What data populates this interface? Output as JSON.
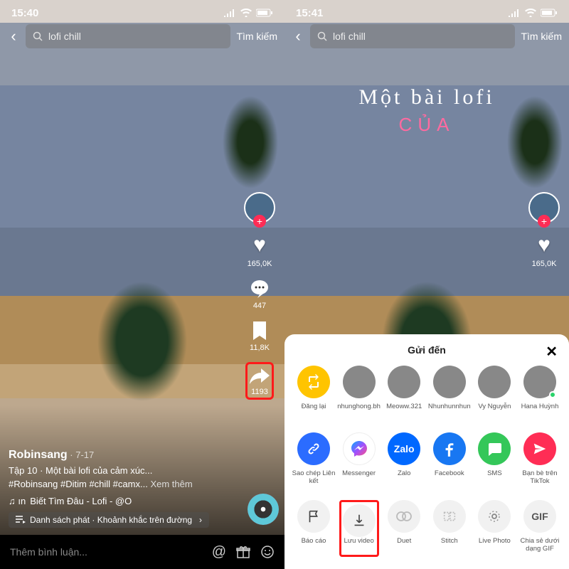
{
  "left": {
    "time": "15:40",
    "search_value": "lofi chill",
    "search_btn": "Tìm kiếm",
    "signal": "•ıl",
    "wifi": "wifi",
    "battery": "batt",
    "likes": "165,0K",
    "comments": "447",
    "bookmarks": "11,8K",
    "shares": "1193",
    "username": "Robinsang",
    "date": "7-17",
    "caption_line": "Tập 10 · Một bài lofi của cảm xúc...",
    "hashtags": "#Robinsang #Ditim #chill #camx...",
    "see_more": "Xem thêm",
    "music": "Biết Tìm Đâu - Lofi - @O",
    "music_prefix": "♫ ın",
    "playlist": "Danh sách phát · Khoảnh khắc trên đường",
    "comment_placeholder": "Thêm bình luận..."
  },
  "right": {
    "time": "15:41",
    "search_value": "lofi chill",
    "search_btn": "Tìm kiếm",
    "likes": "165,0K",
    "overlay_line1": "Một bài lofi",
    "overlay_line2": "CỦA",
    "sheet_title": "Gửi đến",
    "contacts": [
      {
        "label": "Đăng lại",
        "type": "repost"
      },
      {
        "label": "nhunghong.bh",
        "type": "avatar"
      },
      {
        "label": "Meoww.321",
        "type": "avatar"
      },
      {
        "label": "Nhunhunnhun",
        "type": "avatar"
      },
      {
        "label": "Vy Nguyễn",
        "type": "avatar"
      },
      {
        "label": "Hana Huỳnh",
        "type": "avatar"
      }
    ],
    "apps": [
      {
        "label": "Sao chép Liên kết",
        "icon": "link",
        "color": "#2b6cff"
      },
      {
        "label": "Messenger",
        "icon": "msgr",
        "color": "#fff"
      },
      {
        "label": "Zalo",
        "icon": "zalo",
        "color": "#0068ff"
      },
      {
        "label": "Facebook",
        "icon": "fb",
        "color": "#1877f2"
      },
      {
        "label": "SMS",
        "icon": "sms",
        "color": "#34c759"
      },
      {
        "label": "Bạn bè trên TikTok",
        "icon": "send",
        "color": "#ff2d55"
      }
    ],
    "actions": [
      {
        "label": "Báo cáo",
        "icon": "flag"
      },
      {
        "label": "Lưu video",
        "icon": "download",
        "highlight": true
      },
      {
        "label": "Duet",
        "icon": "duet"
      },
      {
        "label": "Stitch",
        "icon": "stitch"
      },
      {
        "label": "Live Photo",
        "icon": "live"
      },
      {
        "label": "Chia sẻ dưới dạng GIF",
        "icon": "gif"
      }
    ]
  }
}
